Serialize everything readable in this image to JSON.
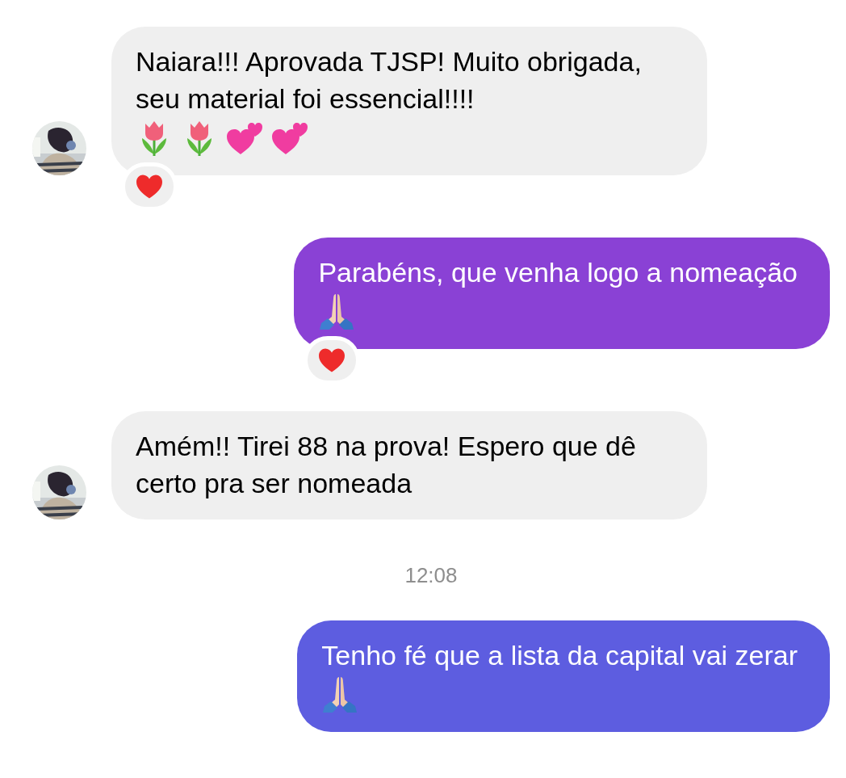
{
  "messages": [
    {
      "kind": "incoming",
      "avatar": true,
      "text": "Naiara!!! Aprovada TJSP! Muito obrigada, seu material foi essencial!!!!",
      "emojis": [
        {
          "kind": "tulip"
        },
        {
          "kind": "tulip"
        },
        {
          "kind": "two-hearts"
        },
        {
          "kind": "two-hearts"
        }
      ],
      "reaction": {
        "kind": "heart"
      }
    },
    {
      "kind": "outgoing",
      "color": "#8a41d5",
      "text": "Parabéns, que venha logo a nomeação",
      "emojis": [
        {
          "kind": "praying-hands"
        }
      ],
      "reaction": {
        "kind": "heart"
      }
    },
    {
      "kind": "incoming",
      "avatar": true,
      "text": "Amém!! Tirei 88 na prova! Espero que dê certo pra ser nomeada"
    },
    {
      "kind": "timestamp",
      "text": "12:08"
    },
    {
      "kind": "outgoing",
      "color": "#5d5de0",
      "text": "Tenho fé que a lista da capital vai zerar",
      "emojis": [
        {
          "kind": "praying-hands"
        }
      ]
    }
  ]
}
